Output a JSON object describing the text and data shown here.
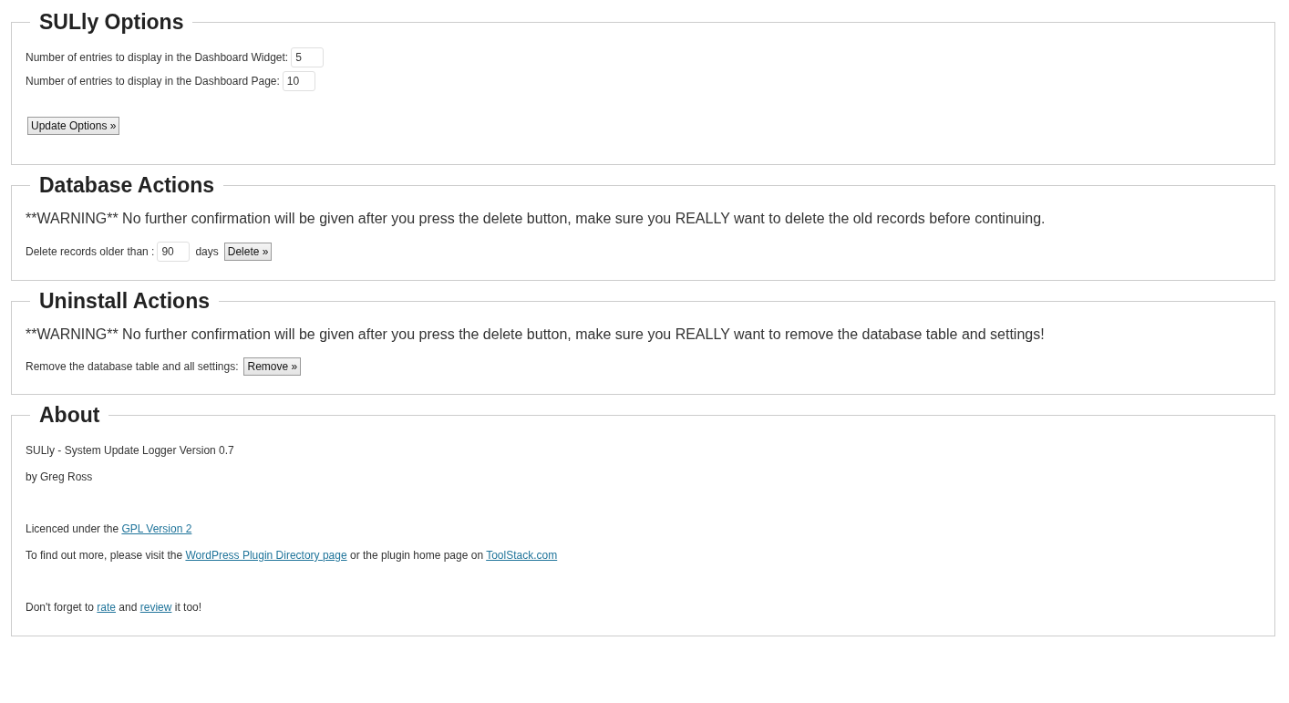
{
  "sections": [
    {
      "title": "SULly Options",
      "items": [
        {
          "kind": "field",
          "label": "Number of entries to display in the Dashboard Widget:",
          "value": "5"
        },
        {
          "kind": "field",
          "label": "Number of entries to display in the Dashboard Page:",
          "value": "10"
        },
        {
          "kind": "button",
          "label": "Update Options »"
        }
      ]
    },
    {
      "title": "Database Actions",
      "items": [
        {
          "kind": "warning",
          "text": "**WARNING** No further confirmation will be given after you press the delete button, make sure you REALLY want to delete the old records before continuing."
        },
        {
          "kind": "action",
          "label": "Delete records older than :",
          "value": "90",
          "suffix": "days",
          "button": "Delete »"
        }
      ]
    },
    {
      "title": "Uninstall Actions",
      "items": [
        {
          "kind": "warning",
          "text": "**WARNING** No further confirmation will be given after you press the delete button, make sure you REALLY want to remove the database table and settings!"
        },
        {
          "kind": "action",
          "label": "Remove the database table and all settings:",
          "button": "Remove »"
        }
      ]
    },
    {
      "title": "About",
      "items": [
        {
          "kind": "text",
          "groups": [
            [
              [
                {
                  "text": "SULly - System Update Logger Version 0.7"
                }
              ],
              [
                {
                  "text": "by Greg Ross"
                }
              ]
            ],
            [
              [
                {
                  "text": "Licenced under the "
                },
                {
                  "link": "GPL Version 2"
                }
              ],
              [
                {
                  "text": "To find out more, please visit the "
                },
                {
                  "link": "WordPress Plugin Directory page"
                },
                {
                  "text": " or the plugin home page on "
                },
                {
                  "link": "ToolStack.com"
                }
              ]
            ],
            [
              [
                {
                  "text": "Don't forget to "
                },
                {
                  "link": "rate"
                },
                {
                  "text": " and "
                },
                {
                  "link": "review"
                },
                {
                  "text": " it too!"
                }
              ]
            ]
          ]
        }
      ]
    }
  ]
}
